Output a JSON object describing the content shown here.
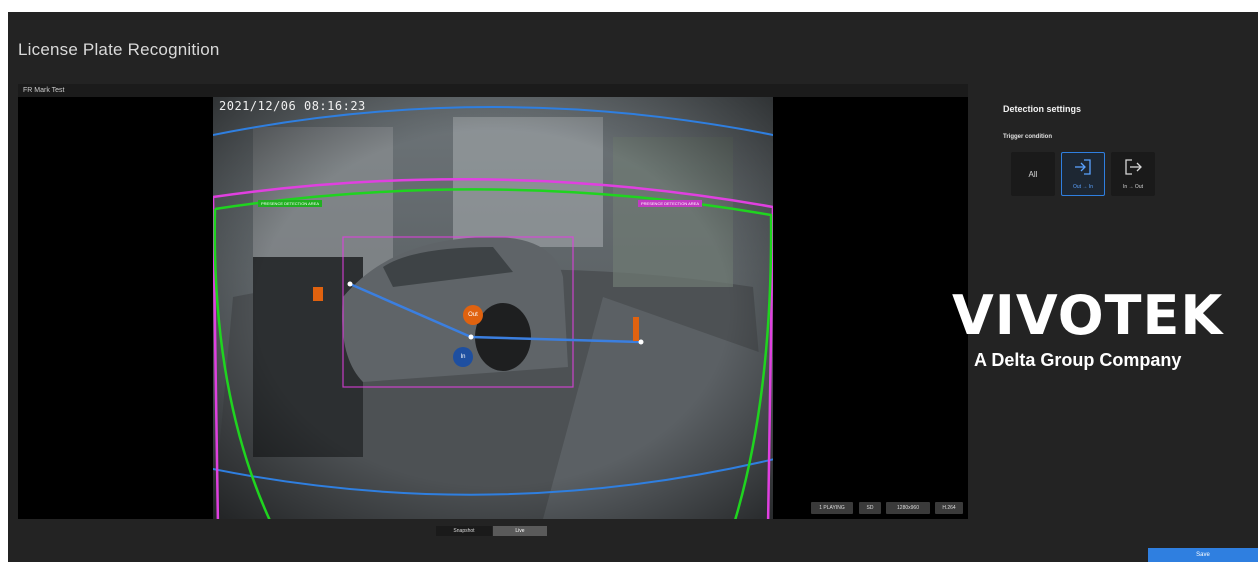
{
  "header": {
    "title": "License Plate Recognition"
  },
  "video": {
    "panel_title": "FR Mark Test",
    "timestamp": "2021/12/06 08:16:23",
    "zone_tag_left": "PRESENCE DETECTION AREA",
    "zone_tag_right": "PRESENCE DETECTION AREA",
    "marker_out": "Out",
    "marker_in": "In",
    "status": [
      "1 PLAYING",
      "SD",
      "1280x960",
      "H.264"
    ]
  },
  "view_modes": {
    "snapshot": "Snapshot",
    "live": "Live",
    "selected": "live"
  },
  "settings": {
    "title": "Detection settings",
    "trigger_label": "Trigger condition",
    "options": [
      {
        "label": "All",
        "icon": "",
        "active": false
      },
      {
        "label": "Out → In",
        "icon": "enter-icon",
        "active": true
      },
      {
        "label": "In → Out",
        "icon": "exit-icon",
        "active": false
      }
    ]
  },
  "branding": {
    "logo": "VIVOTEK",
    "tagline": "A Delta Group Company"
  },
  "footer": {
    "save_label": "Save"
  },
  "colors": {
    "accent": "#2f7fe0",
    "zone_outer": "#00e000",
    "zone_inner": "#e040e0",
    "zone_blue": "#2f7fe0",
    "line": "#3b7fe0",
    "out_marker": "#e0620f",
    "in_marker": "#1e4fa0"
  }
}
